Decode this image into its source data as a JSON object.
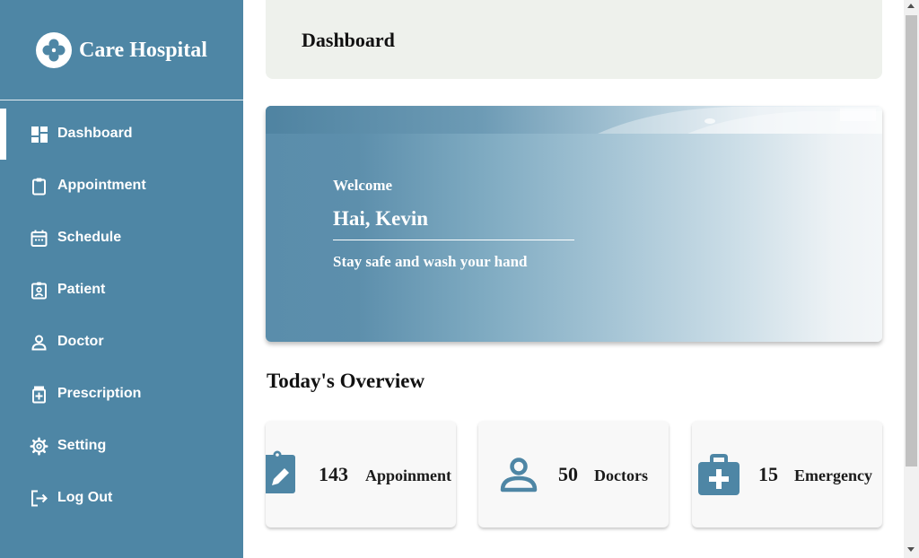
{
  "app": {
    "name": "Care Hospital",
    "logo_icon": "clover-logo-icon"
  },
  "sidebar": {
    "items": [
      {
        "label": "Dashboard",
        "icon": "dashboard-icon",
        "active": true
      },
      {
        "label": "Appointment",
        "icon": "clipboard-icon",
        "active": false
      },
      {
        "label": "Schedule",
        "icon": "calendar-icon",
        "active": false
      },
      {
        "label": "Patient",
        "icon": "badge-icon",
        "active": false
      },
      {
        "label": "Doctor",
        "icon": "person-icon",
        "active": false
      },
      {
        "label": "Prescription",
        "icon": "medicine-icon",
        "active": false
      },
      {
        "label": "Setting",
        "icon": "gear-icon",
        "active": false
      },
      {
        "label": "Log Out",
        "icon": "logout-icon",
        "active": false
      }
    ]
  },
  "header": {
    "title": "Dashboard"
  },
  "welcome": {
    "greeting": "Welcome",
    "name": "Hai, Kevin",
    "message": "Stay safe and wash your hand"
  },
  "overview": {
    "title": "Today's Overview",
    "cards": [
      {
        "value": "143",
        "label": "Appoinment",
        "icon": "clipboard-edit-icon"
      },
      {
        "value": "50",
        "label": "Doctors",
        "icon": "person-icon"
      },
      {
        "value": "15",
        "label": "Emergency",
        "icon": "first-aid-kit-icon"
      }
    ]
  },
  "colors": {
    "sidebar_bg": "#4e86a5",
    "header_bg": "#eef1ec",
    "icon_accent": "#4e86a5",
    "card_bg": "#f8f8f8"
  }
}
